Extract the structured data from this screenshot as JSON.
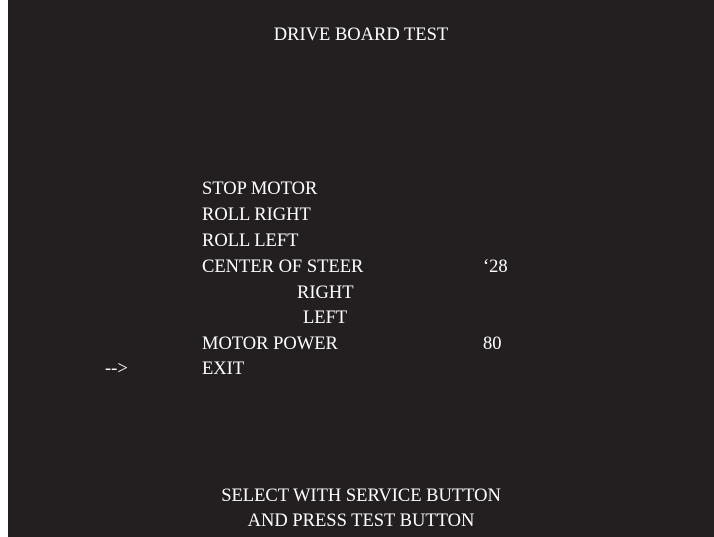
{
  "screen": {
    "title": "DRIVE BOARD TEST",
    "cursor": "-->",
    "menu": [
      {
        "label": "STOP MOTOR"
      },
      {
        "label": "ROLL RIGHT"
      },
      {
        "label": "ROLL LEFT"
      },
      {
        "label": "CENTER OF STEER",
        "value": "‘28"
      },
      {
        "label": "RIGHT"
      },
      {
        "label": "LEFT"
      },
      {
        "label": "MOTOR POWER",
        "value": "80"
      },
      {
        "label": "EXIT",
        "selected": true
      }
    ],
    "instructions": [
      "SELECT WITH SERVICE BUTTON",
      "AND PRESS TEST BUTTON"
    ]
  },
  "colors": {
    "background": "#231f20",
    "text": "#ffffff"
  }
}
